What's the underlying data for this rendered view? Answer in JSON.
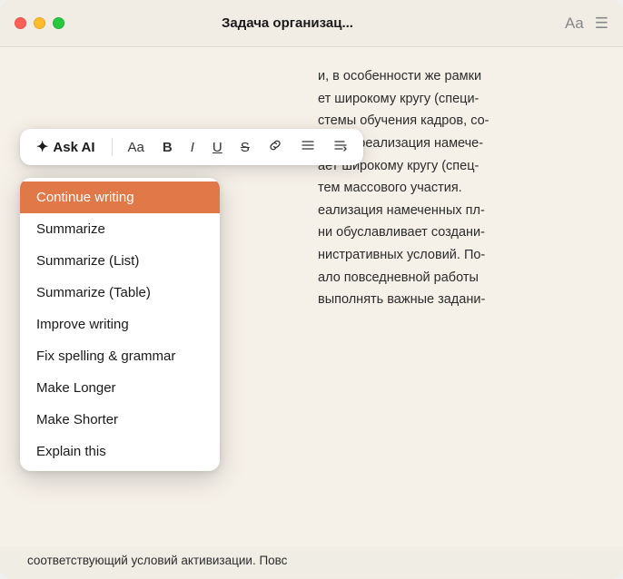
{
  "window": {
    "title": "Задача организац...",
    "traffic_lights": {
      "red": "red",
      "yellow": "yellow",
      "green": "green"
    }
  },
  "title_icons": {
    "font": "Aa",
    "list": "☰"
  },
  "toolbar": {
    "ask_ai": "Ask AI",
    "sparkle": "✦",
    "font_size": "Aa",
    "bold": "B",
    "italic": "I",
    "underline": "U",
    "strikethrough": "S",
    "link": "⌘",
    "align": "≡",
    "more": "⋮"
  },
  "menu": {
    "items": [
      {
        "id": "continue-writing",
        "label": "Continue writing",
        "active": true
      },
      {
        "id": "summarize",
        "label": "Summarize",
        "active": false
      },
      {
        "id": "summarize-list",
        "label": "Summarize (List)",
        "active": false
      },
      {
        "id": "summarize-table",
        "label": "Summarize (Table)",
        "active": false
      },
      {
        "id": "improve-writing",
        "label": "Improve writing",
        "active": false
      },
      {
        "id": "fix-spelling",
        "label": "Fix spelling & grammar",
        "active": false
      },
      {
        "id": "make-longer",
        "label": "Make Longer",
        "active": false
      },
      {
        "id": "make-shorter",
        "label": "Make Shorter",
        "active": false
      },
      {
        "id": "explain",
        "label": "Explain this",
        "active": false
      }
    ]
  },
  "doc": {
    "line1": "и, в особенности же рамки",
    "line2": "ет широкому кругу (специ-",
    "line3": "стемы обучения кадров, со-",
    "line4": "рищи! реализация намече-",
    "line5": "ает широкому кругу (спец-",
    "line6": "тем массового участия.",
    "line7": "еализация намеченных пл-",
    "line8": "ни обуславливает создани-",
    "line9": "нистративных условий. По-",
    "line10": "ало повседневной работы",
    "line11": "выполнять важные задани-",
    "bottom": "соответствующий условий активизации. Повс"
  },
  "colors": {
    "active_menu_bg": "#e07848",
    "active_menu_text": "#ffffff",
    "body_bg": "#f5f0e8"
  }
}
